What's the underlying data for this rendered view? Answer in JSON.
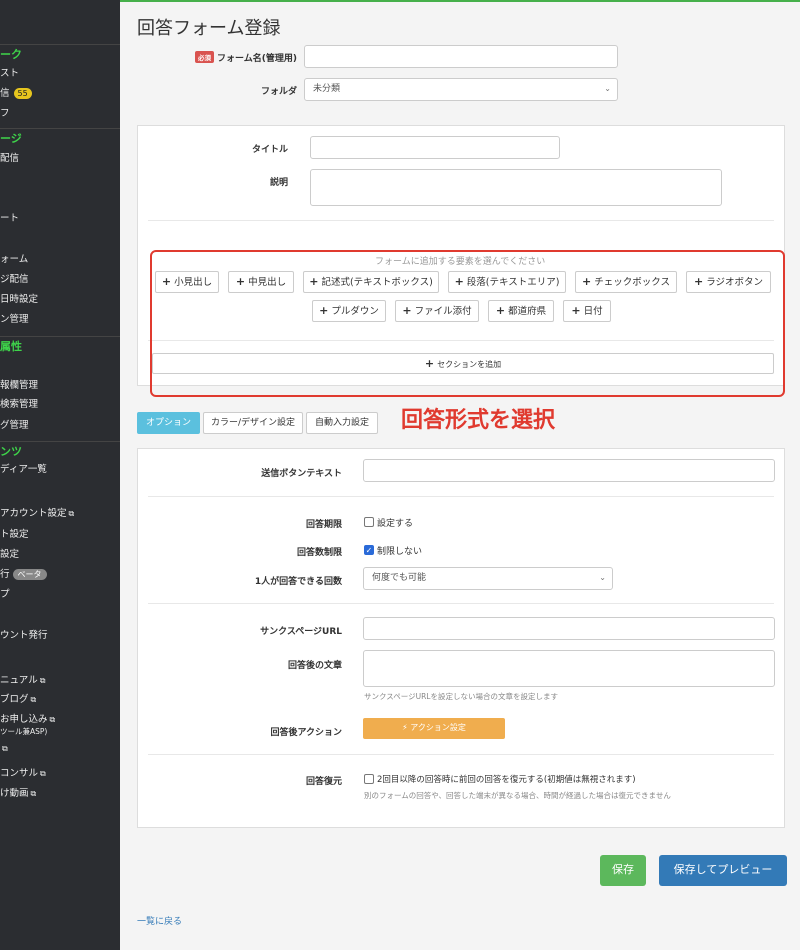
{
  "sidebar": {
    "items": [
      {
        "kind": "head",
        "label": "ーク"
      },
      {
        "kind": "item",
        "label": "スト"
      },
      {
        "kind": "item",
        "label": "信",
        "badge": "55"
      },
      {
        "kind": "item",
        "label": "フ"
      },
      {
        "kind": "head",
        "label": "ージ"
      },
      {
        "kind": "item",
        "label": "配信"
      },
      {
        "kind": "item",
        "label": "ート"
      },
      {
        "kind": "item",
        "label": "ォーム"
      },
      {
        "kind": "item",
        "label": "ジ配信"
      },
      {
        "kind": "item",
        "label": "日時設定"
      },
      {
        "kind": "item",
        "label": "ン管理"
      },
      {
        "kind": "head",
        "label": "属性"
      },
      {
        "kind": "item",
        "label": "報欄管理"
      },
      {
        "kind": "item",
        "label": "検索管理"
      },
      {
        "kind": "item",
        "label": "グ管理"
      },
      {
        "kind": "head",
        "label": "ンツ"
      },
      {
        "kind": "item",
        "label": "ディア一覧"
      },
      {
        "kind": "item",
        "label": "アカウント設定",
        "ext": "⧉"
      },
      {
        "kind": "item",
        "label": "ト設定"
      },
      {
        "kind": "item",
        "label": "設定"
      },
      {
        "kind": "item",
        "label": "行",
        "badge_gray": "ベータ"
      },
      {
        "kind": "item",
        "label": "プ"
      },
      {
        "kind": "item",
        "label": "ウント発行"
      },
      {
        "kind": "item",
        "label": "ニュアル",
        "ext": "⧉"
      },
      {
        "kind": "item",
        "label": "ブログ",
        "ext": "⧉"
      },
      {
        "kind": "item",
        "label": "お申し込み",
        "ext": "⧉",
        "sub": "ツール兼ASP)"
      },
      {
        "kind": "item",
        "label": "",
        "ext": "⧉"
      },
      {
        "kind": "item",
        "label": "コンサル",
        "ext": "⧉"
      },
      {
        "kind": "item",
        "label": "け動画",
        "ext": "⧉"
      }
    ]
  },
  "page": {
    "title": "回答フォーム登録",
    "required_badge": "必須",
    "form_name_label": "フォーム名(管理用)",
    "folder_label": "フォルダ",
    "folder_value": "未分類",
    "chevron": "⌄"
  },
  "content": {
    "title_label": "タイトル",
    "description_label": "説明",
    "add_hint": "フォームに追加する要素を選んでください",
    "elements": [
      {
        "label": "小見出し"
      },
      {
        "label": "中見出し"
      },
      {
        "label": "記述式(テキストボックス)"
      },
      {
        "label": "段落(テキストエリア)"
      },
      {
        "label": "チェックボックス"
      },
      {
        "label": "ラジオボタン"
      },
      {
        "label": "プルダウン"
      },
      {
        "label": "ファイル添付"
      },
      {
        "label": "都道府県"
      },
      {
        "label": "日付"
      }
    ],
    "plus": "+",
    "add_section": "セクションを追加",
    "annotation": "回答形式を選択"
  },
  "tabs": [
    {
      "label": "オプション",
      "active": true
    },
    {
      "label": "カラー/デザイン設定",
      "active": false
    },
    {
      "label": "自動入力設定",
      "active": false
    }
  ],
  "options": {
    "submit_text_label": "送信ボタンテキスト",
    "deadline_label": "回答期限",
    "deadline_check": "設定する",
    "limit_label": "回答数制限",
    "limit_check": "制限しない",
    "per_person_label": "1人が回答できる回数",
    "per_person_value": "何度でも可能",
    "thanks_url_label": "サンクスページURL",
    "after_text_label": "回答後の文章",
    "after_text_hint": "サンクスページURLを設定しない場合の文章を設定します",
    "after_action_label": "回答後アクション",
    "action_button": "⚡ アクション設定",
    "restore_label": "回答復元",
    "restore_check": "2回目以降の回答時に前回の回答を復元する(初期値は無視されます)",
    "restore_hint": "別のフォームの回答や、回答した端末が異なる場合、時間が経過した場合は復元できません"
  },
  "footer": {
    "save": "保存",
    "save_preview": "保存してプレビュー",
    "back": "一覧に戻る"
  },
  "colors": {
    "accent_green": "#3ed34a",
    "annotation_red": "#e03a2f",
    "tab_active": "#5bc0de",
    "action_orange": "#f0ad4e",
    "save_green": "#5cb85c",
    "preview_blue": "#337ab7"
  }
}
